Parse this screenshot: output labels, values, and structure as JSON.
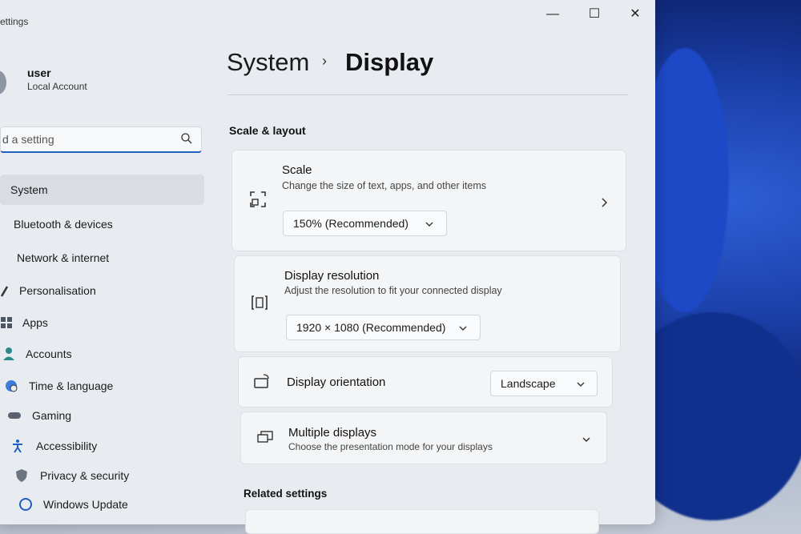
{
  "window": {
    "app_title": "ettings",
    "minimize_label": "—",
    "maximize_label": "☐",
    "close_label": "✕"
  },
  "profile": {
    "name": "user",
    "account_type": "Local Account"
  },
  "search": {
    "placeholder": "d a setting"
  },
  "sidebar": {
    "items": [
      {
        "label": "System",
        "icon": "monitor-icon",
        "active": true
      },
      {
        "label": "Bluetooth & devices",
        "icon": "bluetooth-icon"
      },
      {
        "label": "Network & internet",
        "icon": "wifi-icon"
      },
      {
        "label": "Personalisation",
        "icon": "brush-icon"
      },
      {
        "label": "Apps",
        "icon": "apps-icon"
      },
      {
        "label": "Accounts",
        "icon": "person-icon"
      },
      {
        "label": "Time & language",
        "icon": "globe-clock-icon"
      },
      {
        "label": "Gaming",
        "icon": "gamepad-icon"
      },
      {
        "label": "Accessibility",
        "icon": "accessibility-icon"
      },
      {
        "label": "Privacy & security",
        "icon": "shield-icon"
      },
      {
        "label": "Windows Update",
        "icon": "update-icon"
      }
    ]
  },
  "breadcrumb": {
    "root": "System",
    "separator": "›",
    "current": "Display"
  },
  "scale_layout": {
    "title": "Scale & layout",
    "scale": {
      "title": "Scale",
      "description": "Change the size of text, apps, and other items",
      "value": "150% (Recommended)"
    },
    "resolution": {
      "title": "Display resolution",
      "description": "Adjust the resolution to fit your connected display",
      "value": "1920 × 1080 (Recommended)"
    },
    "orientation": {
      "title": "Display orientation",
      "value": "Landscape"
    },
    "multiple_displays": {
      "title": "Multiple displays",
      "description": "Choose the presentation mode for your displays"
    }
  },
  "related": {
    "title": "Related settings"
  },
  "colors": {
    "accent": "#1f5fbf",
    "window_bg": "#e8ecf1",
    "card_bg": "#f3f5f7"
  }
}
